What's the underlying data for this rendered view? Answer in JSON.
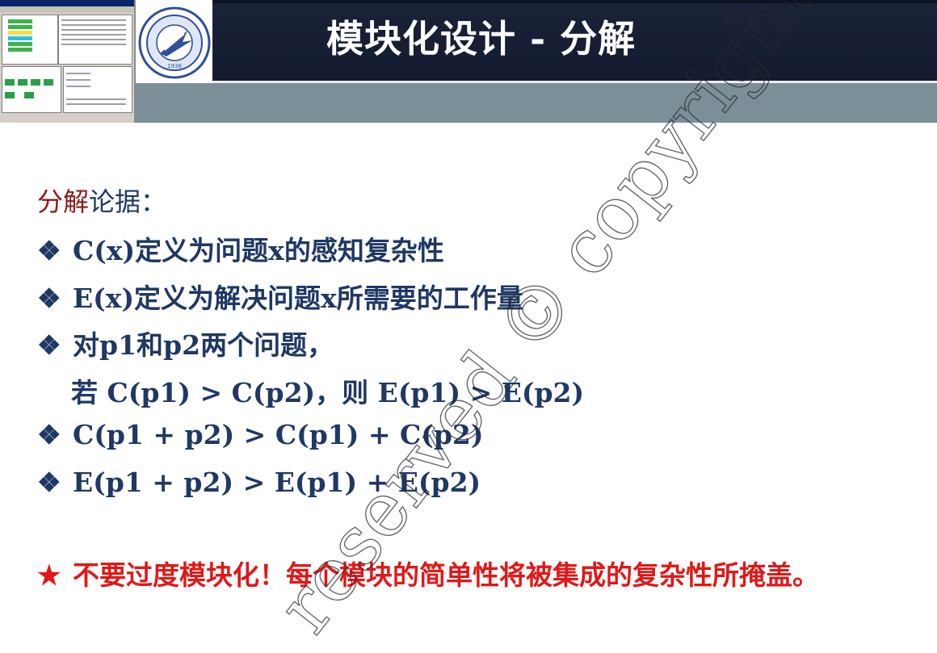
{
  "slide": {
    "title": "模块化设计 - 分解",
    "heading_red": "分解",
    "heading_blue": "论据：",
    "bullet_glyph": "❖",
    "lines": [
      "C(x)定义为问题x的感知复杂性",
      "E(x)定义为解决问题x所需要的工作量",
      "对p1和p2两个问题，",
      "若 C(p1) > C(p2)，则 E(p1) > E(p2)",
      "C(p1 + p2) > C(p1) + C(p2)",
      "E(p1 + p2) > E(p1) + E(p2)"
    ],
    "warning_star": "★",
    "warning_text": "不要过度模块化！每个模块的简单性将被集成的复杂性所掩盖。",
    "watermark": "reserved © copyright"
  },
  "colors": {
    "header_dark": "#141b30",
    "header_grey": "#7b8f99",
    "heading_red": "#8b1a1a",
    "text_blue": "#1f3864",
    "warning_red": "#e01818"
  }
}
